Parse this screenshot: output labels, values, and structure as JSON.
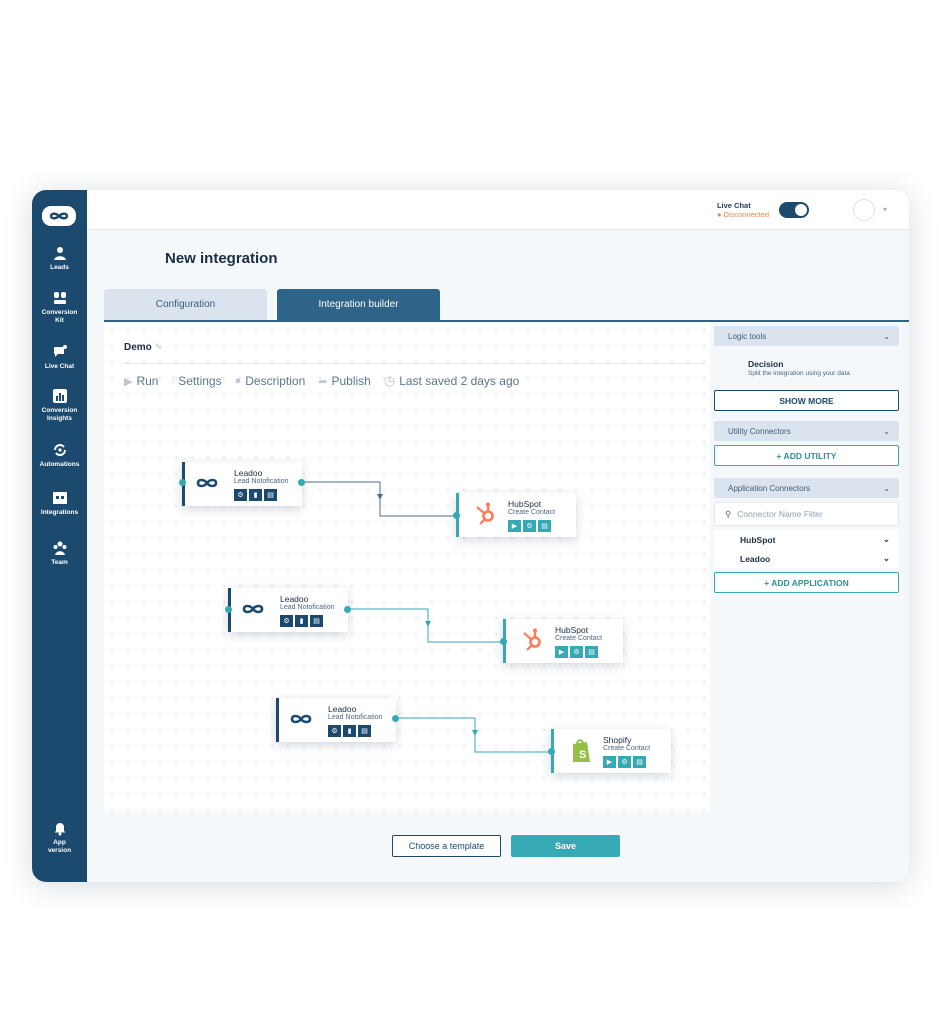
{
  "sidebar": {
    "items": [
      {
        "label": "Leads",
        "icon": "star-person-icon"
      },
      {
        "label": "Conversion Kit",
        "icon": "conversion-kit-icon"
      },
      {
        "label": "Live Chat",
        "icon": "chat-icon"
      },
      {
        "label": "Conversion Insights",
        "icon": "bar-chart-icon"
      },
      {
        "label": "Automations",
        "icon": "automation-icon"
      },
      {
        "label": "Integrations",
        "icon": "integrations-icon"
      },
      {
        "label": "Team",
        "icon": "team-icon"
      }
    ],
    "bottom": {
      "label": "App version",
      "icon": "bell-icon"
    }
  },
  "topbar": {
    "live_chat_label": "Live Chat",
    "live_chat_status": "● Disconnected"
  },
  "page": {
    "title": "New integration"
  },
  "tabs": {
    "configuration": "Configuration",
    "builder": "Integration builder"
  },
  "builder": {
    "name": "Demo",
    "toolbar": {
      "run": "Run",
      "settings": "Settings",
      "description": "Description",
      "publish": "Publish",
      "last_saved": "Last saved 2 days ago"
    },
    "nodes": [
      {
        "name": "Leadoo",
        "action": "Lead Notofication"
      },
      {
        "name": "HubSpot",
        "action": "Create Contact"
      },
      {
        "name": "Leadoo",
        "action": "Lead Notofication"
      },
      {
        "name": "HubSpot",
        "action": "Create Contact"
      },
      {
        "name": "Leadoo",
        "action": "Lead Notofication"
      },
      {
        "name": "Shopify",
        "action": "Create Contact"
      }
    ]
  },
  "panel": {
    "logic_tools": "Logic tools",
    "decision_title": "Decision",
    "decision_desc": "Split the integration using your data",
    "show_more": "SHOW MORE",
    "utility_connectors": "Utility Connectors",
    "add_utility": "+ ADD UTILITY",
    "application_connectors": "Application Connectors",
    "filter_placeholder": "Connector Name Filter",
    "connectors": [
      "HubSpot",
      "Leadoo"
    ],
    "add_application": "+ ADD APPLICATION"
  },
  "footer": {
    "choose_template": "Choose a template",
    "save": "Save"
  },
  "colors": {
    "sidebar": "#1b4a6e",
    "accent": "#35a9b4",
    "hubspot": "#ff7a59",
    "shopify": "#95bf47"
  }
}
